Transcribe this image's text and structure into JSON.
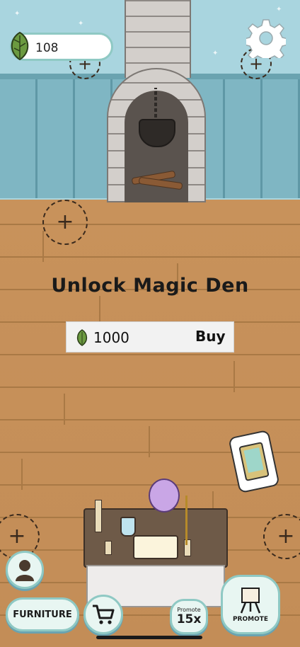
{
  "currency": {
    "leaves": "108",
    "icon": "leaf-icon"
  },
  "settings": {
    "icon": "gear-icon"
  },
  "unlock": {
    "title": "Unlock Magic Den",
    "cost": "1000",
    "buy_label": "Buy"
  },
  "placement_spot": {
    "symbol": "+"
  },
  "toolbar": {
    "furniture_label": "FURNITURE",
    "promote_small_label": "Promote",
    "promote_multiplier": "15x",
    "promote_label": "PROMOTE",
    "profile_icon": "person-icon",
    "cart_icon": "cart-icon",
    "easel_icon": "easel-icon"
  },
  "colors": {
    "wall": "#a9d5df",
    "wall_panel": "#7fb6c3",
    "floor": "#c8925b",
    "button_fill": "#e8f6f2",
    "button_border": "#8fc9c4",
    "leaf_green": "#5f8f3a"
  }
}
